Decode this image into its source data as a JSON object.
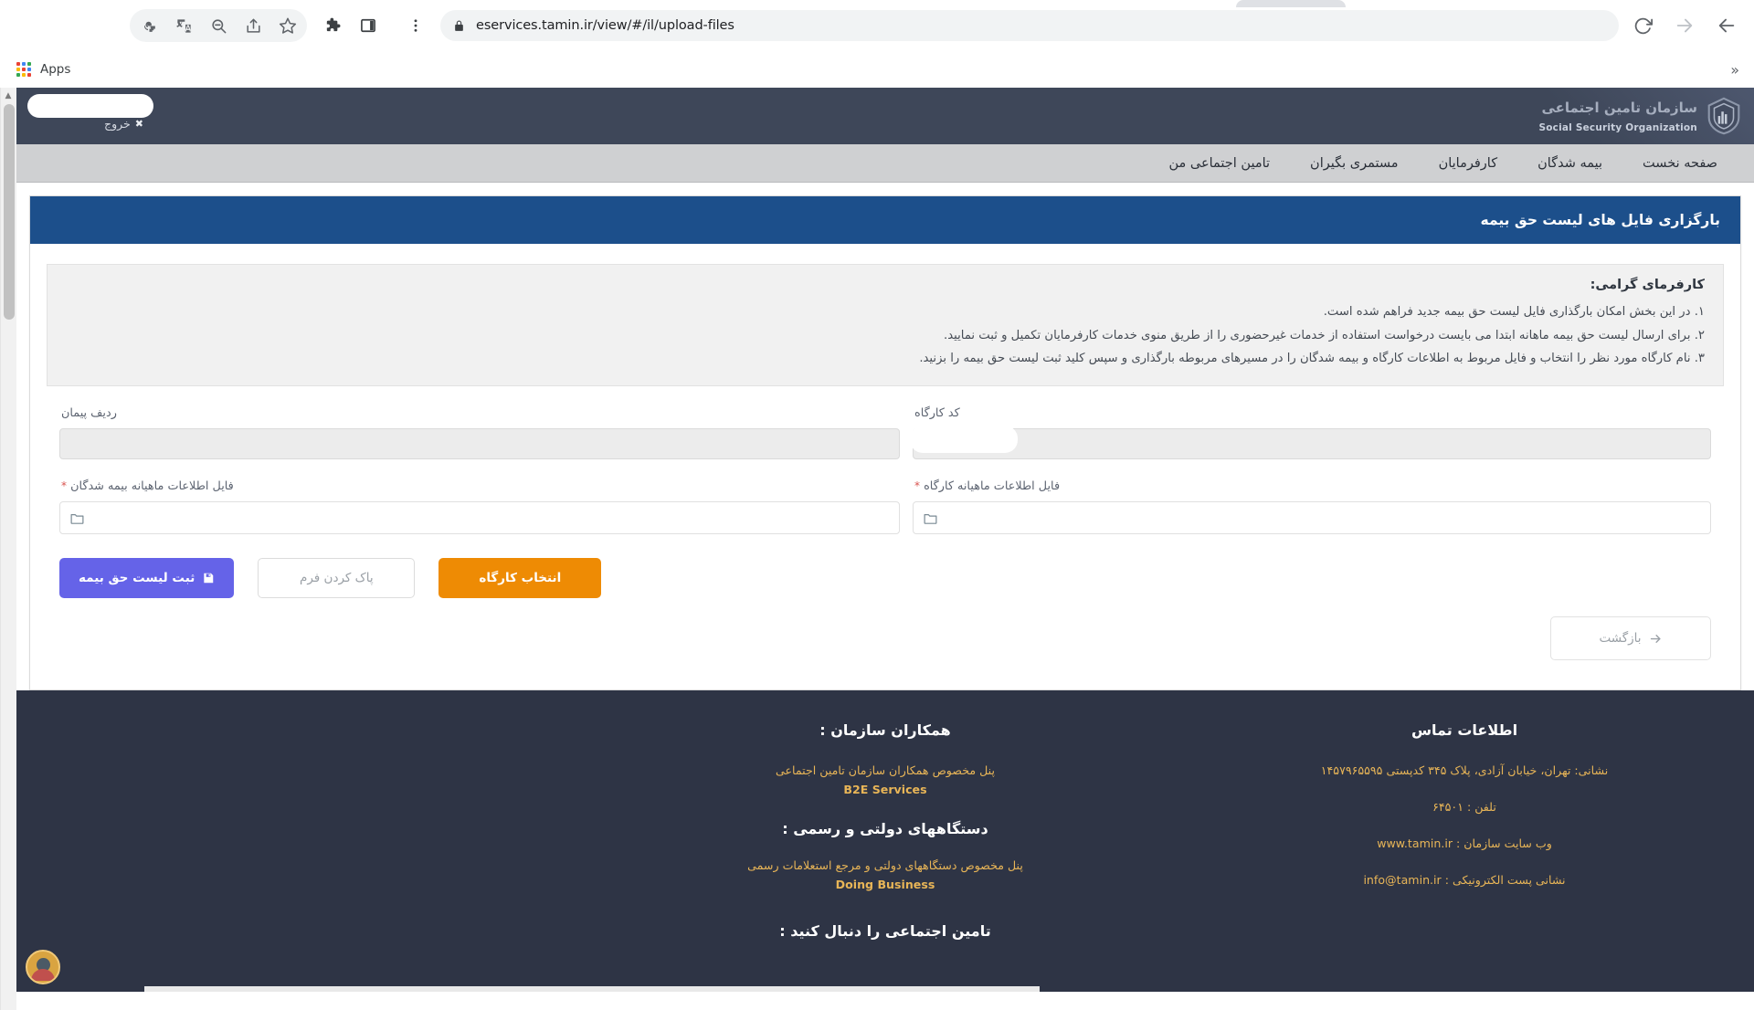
{
  "browser": {
    "url": "eservices.tamin.ir/view/#/il/upload-files",
    "nav_icons": [
      "back-arrow-icon",
      "forward-arrow-icon",
      "reload-icon"
    ],
    "lock_icon": "lock-icon",
    "toolbar_icons": [
      "key-icon",
      "translate-icon",
      "zoom-out-icon",
      "share-icon",
      "star-icon",
      "extensions-puzzle-icon",
      "side-panel-icon",
      "three-dot-menu-icon"
    ],
    "bookmarks": {
      "apps_label": "Apps",
      "apps_icon": "apps-grid-icon",
      "overflow_icon": "chevron-double-right-icon"
    }
  },
  "header": {
    "logo_fa": "سازمان تامین اجتماعی",
    "logo_en": "Social Security Organization",
    "logo_icon": "shield-logo-icon",
    "logout_label": "خروج",
    "logout_icon": "close-x-icon"
  },
  "nav": {
    "items": [
      {
        "label": "صفحه نخست",
        "name": "nav-item-home"
      },
      {
        "label": "بیمه شدگان",
        "name": "nav-item-insured"
      },
      {
        "label": "کارفرمایان",
        "name": "nav-item-employers"
      },
      {
        "label": "مستمری بگیران",
        "name": "nav-item-pensioners"
      },
      {
        "label": "تامین اجتماعی من",
        "name": "nav-item-my-social-security"
      }
    ]
  },
  "card": {
    "title": "بارگزاری فایل های لیست حق بیمه",
    "notice": {
      "title": "کارفرمای گرامی:",
      "lines": [
        "۱. در این بخش امکان بارگذاری فایل لیست حق بیمه جدید فراهم شده است.",
        "۲. برای ارسال لیست حق بیمه ماهانه ابتدا می بایست درخواست استفاده از خدمات غیرحضوری را از طریق منوی خدمات کارفرمایان تکمیل و ثبت نمایید.",
        "۳. نام کارگاه مورد نظر را انتخاب و فایل مربوط به اطلاعات کارگاه و بیمه شدگان را در مسیرهای مربوطه بارگذاری و سپس کلید ثبت لیست حق بیمه را بزنید."
      ]
    },
    "fields": {
      "workshop_code_label": "کد کارگاه",
      "workshop_code_value": "",
      "contract_row_label": "ردیف پیمان",
      "contract_row_value": "",
      "workshop_file_label": "فایل اطلاعات ماهیانه کارگاه",
      "workshop_file_required": "*",
      "workshop_file_value": "",
      "insured_file_label": "فایل اطلاعات ماهیانه بیمه شدگان",
      "insured_file_required": "*",
      "insured_file_value": "",
      "folder_icon": "folder-icon"
    },
    "buttons": {
      "submit_label": "ثبت لیست حق بیمه",
      "submit_icon": "save-disk-icon",
      "clear_label": "پاک کردن فرم",
      "select_workshop_label": "انتخاب کارگاه",
      "back_label": "بازگشت",
      "back_icon": "arrow-right-icon"
    },
    "colors": {
      "header_blue": "#1c4f8b",
      "submit_purple": "#6563e8",
      "workshop_orange": "#ee8b04",
      "required_red": "#d9534f"
    }
  },
  "footer": {
    "contact": {
      "heading": "اطلاعات تماس",
      "address": "نشانی: تهران، خیابان آزادی، پلاک ۳۴۵ کدپستی ۱۴۵۷۹۶۵۵۹۵",
      "phone": "تلفن : ۶۴۵۰۱",
      "website": "وب سایت سازمان : www.tamin.ir",
      "email": "نشانی پست الکترونیکی : info@tamin.ir"
    },
    "partners": {
      "heading": "همکاران سازمان :",
      "line": "پنل مخصوص همکاران سازمان تامین اجتماعی",
      "link": "B2E Services",
      "gov_heading": "دستگاههای دولتی و رسمی :",
      "gov_line": "پنل مخصوص دستگاههای دولتی و مرجع استعلامات رسمی",
      "gov_link": "Doing Business"
    },
    "follow_heading": "تامین اجتماعی را دنبال کنید :",
    "avatar_icon": "user-avatar-icon"
  },
  "colors": {
    "header_dark": "#3e4759",
    "nav_gray": "#cfd0d2",
    "footer_dark": "#2e3445",
    "footer_gold": "#e8b557"
  }
}
